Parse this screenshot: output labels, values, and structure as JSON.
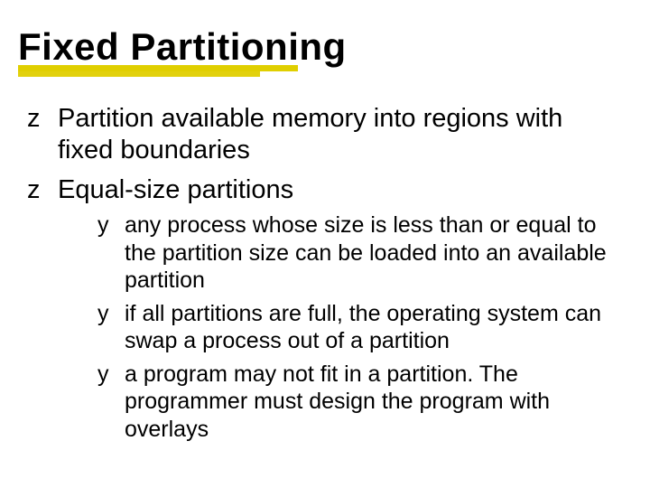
{
  "title": "Fixed Partitioning",
  "bullets": {
    "top_marker": "z",
    "sub_marker": "y",
    "top": [
      "Partition available memory into regions with fixed boundaries",
      "Equal-size partitions"
    ],
    "sub": [
      "any process whose size is less than or equal to the partition size can be loaded into an available partition",
      "if all partitions are full, the operating system can swap a process out of a partition",
      "a program may not fit in a partition.  The programmer must design the program with overlays"
    ]
  }
}
